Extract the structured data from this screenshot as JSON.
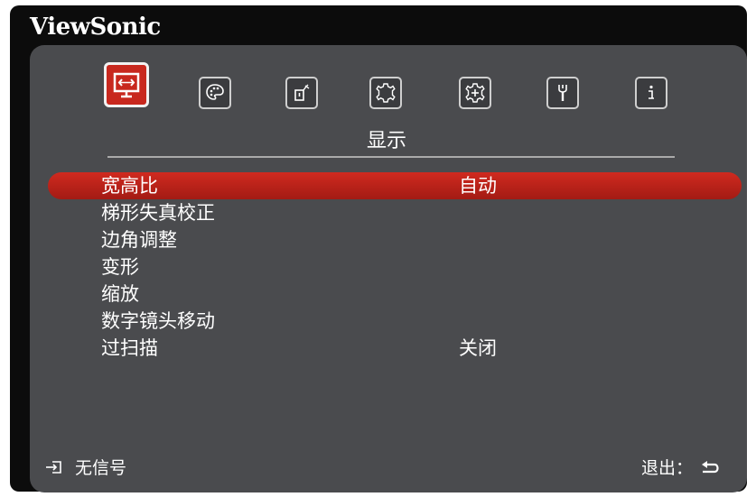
{
  "brand": "ViewSonic",
  "tabs": [
    {
      "name": "display",
      "icon": "display-icon",
      "active": true
    },
    {
      "name": "image",
      "icon": "palette-icon",
      "active": false
    },
    {
      "name": "power",
      "icon": "power-plug-icon",
      "active": false
    },
    {
      "name": "basic",
      "icon": "gear-outline-icon",
      "active": false
    },
    {
      "name": "advanced",
      "icon": "gear-plus-icon",
      "active": false
    },
    {
      "name": "system",
      "icon": "wrench-icon",
      "active": false
    },
    {
      "name": "information",
      "icon": "info-icon",
      "active": false
    }
  ],
  "active_tab_label": "显示",
  "menu": [
    {
      "label": "宽高比",
      "value": "自动",
      "selected": true
    },
    {
      "label": "梯形失真校正",
      "value": ""
    },
    {
      "label": "边角调整",
      "value": ""
    },
    {
      "label": "变形",
      "value": ""
    },
    {
      "label": "缩放",
      "value": ""
    },
    {
      "label": "数字镜头移动",
      "value": ""
    },
    {
      "label": "过扫描",
      "value": "关闭"
    }
  ],
  "footer": {
    "source_icon": "input-source-icon",
    "status": "无信号",
    "exit_label": "退出：",
    "exit_icon": "return-arrow-icon"
  },
  "colors": {
    "accent": "#c8281e",
    "panel": "#4a4b4e",
    "frame": "#0c0c0c"
  }
}
